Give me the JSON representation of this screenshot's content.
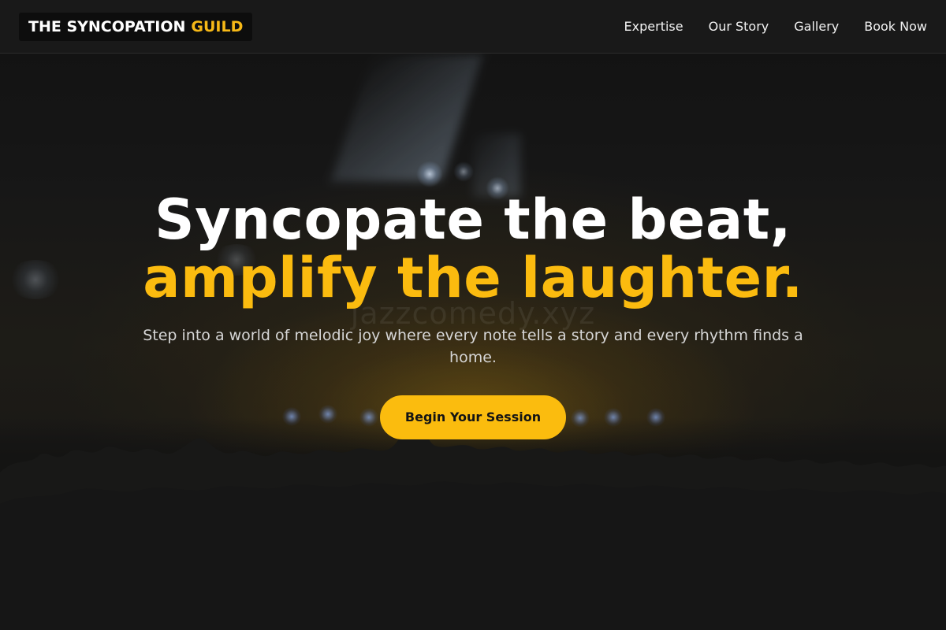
{
  "nav": {
    "brand_main": "THE SYNCOPATION",
    "brand_accent": "GUILD",
    "links": [
      {
        "label": "Expertise"
      },
      {
        "label": "Our Story"
      },
      {
        "label": "Gallery"
      },
      {
        "label": "Book Now"
      }
    ]
  },
  "hero": {
    "headline_line1": "Syncopate the beat,",
    "headline_line2": "amplify the laughter.",
    "subtitle": "Step into a world of melodic joy where every note tells a story and every rhythm finds a home.",
    "cta_label": "Begin Your Session",
    "watermark": "jazzcomedy.xyz"
  },
  "colors": {
    "accent": "#fbbb0f",
    "nav_background": "#1a1a1a",
    "page_background": "#161616",
    "text_primary": "#ffffff",
    "text_secondary": "#d6d6d6"
  }
}
